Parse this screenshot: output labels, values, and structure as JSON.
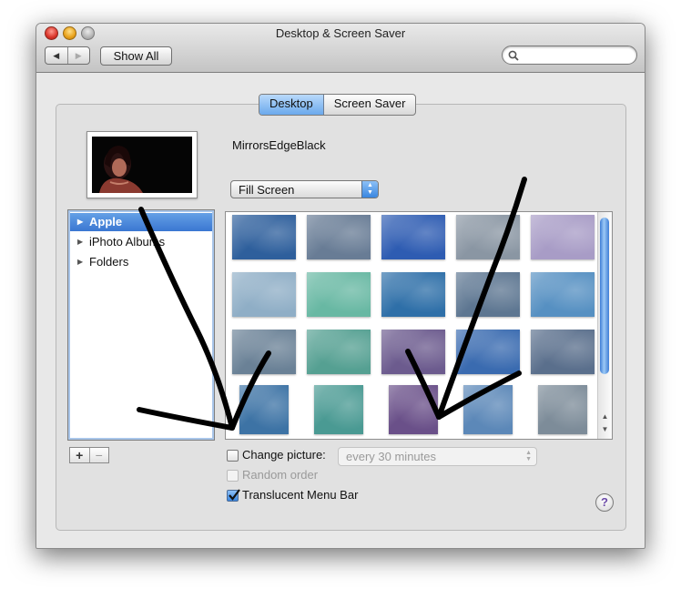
{
  "window": {
    "title": "Desktop & Screen Saver",
    "back_icon": "◀",
    "forward_icon": "▶",
    "show_all_label": "Show All",
    "search": {
      "placeholder": "",
      "value": ""
    }
  },
  "tabs": [
    {
      "label": "Desktop",
      "active": true
    },
    {
      "label": "Screen Saver",
      "active": false
    }
  ],
  "current_picture": {
    "name": "MirrorsEdgeBlack"
  },
  "fit_popup": {
    "selected": "Fill Screen"
  },
  "source_list": {
    "items": [
      {
        "label": "Apple",
        "selected": true
      },
      {
        "label": "iPhoto Albums",
        "selected": false
      },
      {
        "label": "Folders",
        "selected": false
      }
    ],
    "add_label": "+",
    "remove_label": "−"
  },
  "wallpapers": {
    "rows": [
      [
        "#2e5f9c",
        "#687c95",
        "#2e5cb2",
        "#8a96a3",
        "#a89cc6"
      ],
      [
        "#8faec6",
        "#68b8a3",
        "#2e6fa8",
        "#5d7691",
        "#5690c2"
      ],
      [
        "#6a8196",
        "#55a092",
        "#6c5b8e",
        "#3a6bb0",
        "#5a6f8c"
      ],
      [
        "#3d73a5",
        "#4a9a93",
        "#6a5089",
        "#5c88b8",
        "#7d8c99"
      ]
    ]
  },
  "options": {
    "change_picture": {
      "label": "Change picture:",
      "checked": false
    },
    "interval": {
      "selected": "every 30 minutes"
    },
    "random_order": {
      "label": "Random order",
      "checked": false,
      "enabled": false
    },
    "translucent_menu_bar": {
      "label": "Translucent Menu Bar",
      "checked": true
    }
  },
  "help_label": "?",
  "colors": {
    "selection_blue": "#3a77d2",
    "annotation_ink": "#000000"
  }
}
